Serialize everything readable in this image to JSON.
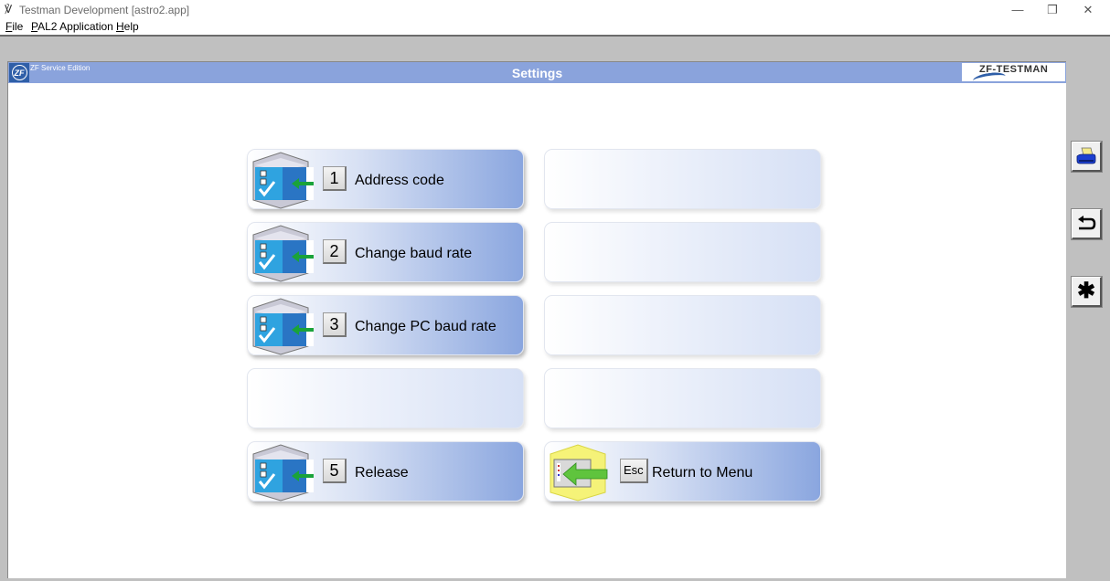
{
  "window": {
    "title": "Testman Development [astro2.app]",
    "controls": {
      "minimize": "—",
      "restore": "❐",
      "close": "✕"
    }
  },
  "menu": [
    {
      "label": "File",
      "accel": "F",
      "rest": "ile"
    },
    {
      "label": "PAL2 Application",
      "accel": "P",
      "rest": "AL2 Application"
    },
    {
      "label": "Help",
      "accel": "H",
      "rest": "elp"
    }
  ],
  "header": {
    "logo": "ZF",
    "edition": "ZF Service Edition",
    "title": "Settings",
    "brand": "ZF-TESTMAN",
    "colors": {
      "band": "#8aa3dc",
      "logo": "#2f5fa8"
    }
  },
  "tiles": [
    {
      "key": "1",
      "label": "Address code",
      "icon": "checklist-cube-icon"
    },
    {
      "key": "2",
      "label": "Change baud rate",
      "icon": "checklist-cube-icon"
    },
    {
      "key": "3",
      "label": "Change PC baud rate",
      "icon": "checklist-cube-icon"
    },
    {
      "key": "5",
      "label": "Release",
      "icon": "checklist-cube-icon"
    },
    {
      "key": "Esc",
      "label": "Return to Menu",
      "icon": "return-cube-icon"
    }
  ],
  "side_buttons": [
    {
      "name": "print",
      "icon": "printer-icon"
    },
    {
      "name": "back",
      "icon": "return-arrow-icon"
    },
    {
      "name": "special",
      "icon": "asterisk-icon",
      "glyph": "✱"
    }
  ]
}
